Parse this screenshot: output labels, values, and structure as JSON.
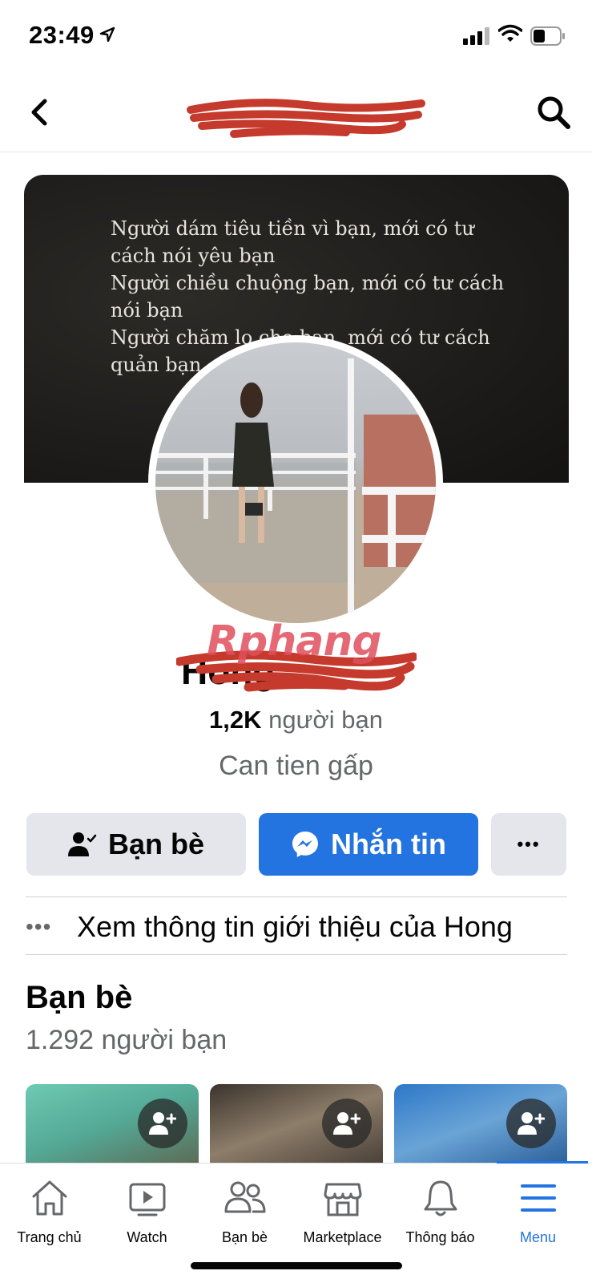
{
  "status_bar": {
    "time": "23:49"
  },
  "profile": {
    "cover_lines": [
      "Người dám tiêu tiền vì bạn, mới có tư",
      "cách nói yêu bạn",
      "Người chiều chuộng bạn, mới có tư cách",
      "nói bạn",
      "Người chăm lo cho bạn, mới có tư cách",
      "quản bạn"
    ],
    "name": "Hong",
    "watermark": "Rphang",
    "friend_count_value": "1,2K",
    "friend_count_label": " người bạn",
    "bio": "Can tien gấp"
  },
  "actions": {
    "friends_label": "Bạn bè",
    "message_label": "Nhắn tin",
    "more_label": "•••"
  },
  "intro": {
    "dots": "•••",
    "text": "Xem thông tin giới thiệu của Hong"
  },
  "friends_section": {
    "title": "Bạn bè",
    "subtitle": "1.292 người bạn"
  },
  "tab_bar": {
    "tabs": [
      {
        "label": "Trang chủ",
        "icon": "home-icon"
      },
      {
        "label": "Watch",
        "icon": "watch-icon"
      },
      {
        "label": "Bạn bè",
        "icon": "friends-icon"
      },
      {
        "label": "Marketplace",
        "icon": "marketplace-icon"
      },
      {
        "label": "Thông báo",
        "icon": "bell-icon"
      },
      {
        "label": "Menu",
        "icon": "menu-icon"
      }
    ],
    "active": "Menu"
  },
  "colors": {
    "accent": "#2374e1",
    "secondary_text": "#65676b",
    "button_grey": "#e4e6eb"
  }
}
